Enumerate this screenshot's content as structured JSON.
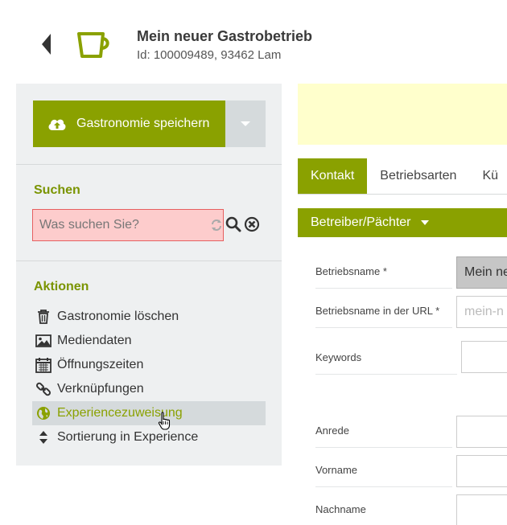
{
  "header": {
    "title": "Mein neuer Gastrobetrieb",
    "subtitle": "Id: 100009489, 93462 Lam",
    "back_icon": "caret-left-icon",
    "type_icon": "coffee-cup-icon"
  },
  "sidebar": {
    "save_label": "Gastronomie speichern",
    "search_heading": "Suchen",
    "search_placeholder": "Was suchen Sie?",
    "actions_heading": "Aktionen",
    "actions": [
      {
        "label": "Gastronomie löschen",
        "icon": "trash-icon"
      },
      {
        "label": "Mediendaten",
        "icon": "image-icon"
      },
      {
        "label": "Öffnungszeiten",
        "icon": "calendar-icon"
      },
      {
        "label": "Verknüpfungen",
        "icon": "link-icon"
      },
      {
        "label": "Experiencezuweisung",
        "icon": "globe-icon",
        "active": true
      },
      {
        "label": "Sortierung in Experience",
        "icon": "sort-icon"
      }
    ]
  },
  "tabs": [
    {
      "label": "Kontakt",
      "active": true
    },
    {
      "label": "Betriebsarten"
    },
    {
      "label": "Kü"
    }
  ],
  "section_dropdown": "Betreiber/Pächter",
  "form": {
    "fields": [
      {
        "label": "Betriebsname *",
        "value": "Mein ne",
        "placeholder": ""
      },
      {
        "label": "Betriebsname in der URL *",
        "value": "",
        "placeholder": "mein-n"
      },
      {
        "label": "Keywords",
        "value": "",
        "placeholder": ""
      },
      {
        "label": "Anrede",
        "value": "",
        "placeholder": ""
      },
      {
        "label": "Vorname",
        "value": "",
        "placeholder": ""
      },
      {
        "label": "Nachname",
        "value": "",
        "placeholder": ""
      }
    ]
  },
  "colors": {
    "accent": "#8aa100",
    "sidebar_bg": "#eef0f1",
    "error_bg": "#fdcccc",
    "notice_bg": "#ffffcc"
  }
}
